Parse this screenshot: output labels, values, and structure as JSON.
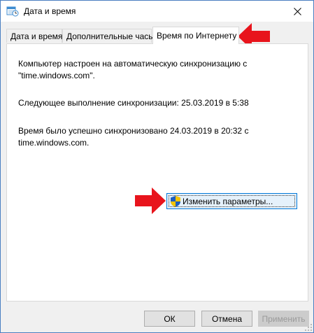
{
  "window": {
    "title": "Дата и время"
  },
  "tabs": [
    {
      "label": "Дата и время"
    },
    {
      "label": "Дополнительные часы"
    },
    {
      "label": "Время по Интернету"
    }
  ],
  "panel": {
    "line1": "Компьютер настроен на автоматическую синхронизацию с \"time.windows.com\".",
    "line2": "Следующее выполнение синхронизации: 25.03.2019 в 5:38",
    "line3": "Время было успешно синхронизовано 24.03.2019 в 20:32 с time.windows.com."
  },
  "change_button": {
    "label": "Изменить параметры..."
  },
  "footer": {
    "ok": "ОК",
    "cancel": "Отмена",
    "apply": "Применить"
  },
  "colors": {
    "arrow": "#e8141c",
    "accent": "#0078d7"
  }
}
